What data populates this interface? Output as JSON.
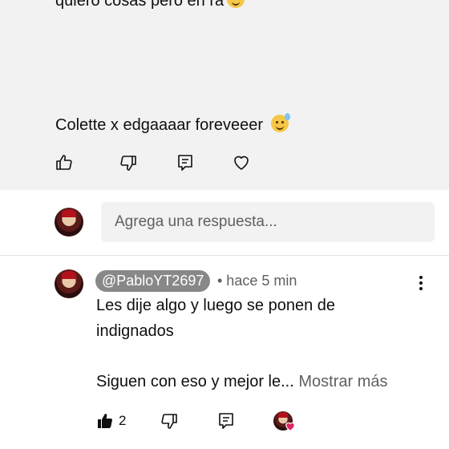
{
  "comment_top": {
    "cut_text": "quiero cosas pero en ra",
    "text": "Colette x edgaaaar foreveeer",
    "emoji": "sweat-smile"
  },
  "reply_box": {
    "placeholder": "Agrega una respuesta..."
  },
  "reply": {
    "handle": "@PabloYT2697",
    "meta": "• hace 5 min",
    "line1": "Les dije algo y luego se ponen de",
    "line2": "indignados",
    "line3": "Siguen con eso y mejor le...",
    "more": "Mostrar más",
    "likes": "2"
  },
  "icons": [
    "thumb-up-icon",
    "thumb-down-icon",
    "reply-icon",
    "heart-icon",
    "kebab-menu-icon"
  ],
  "colors": {
    "card_bg": "#f2f2f2",
    "handle_bg": "#888888",
    "muted": "#606060",
    "heart": "#e0245e"
  }
}
